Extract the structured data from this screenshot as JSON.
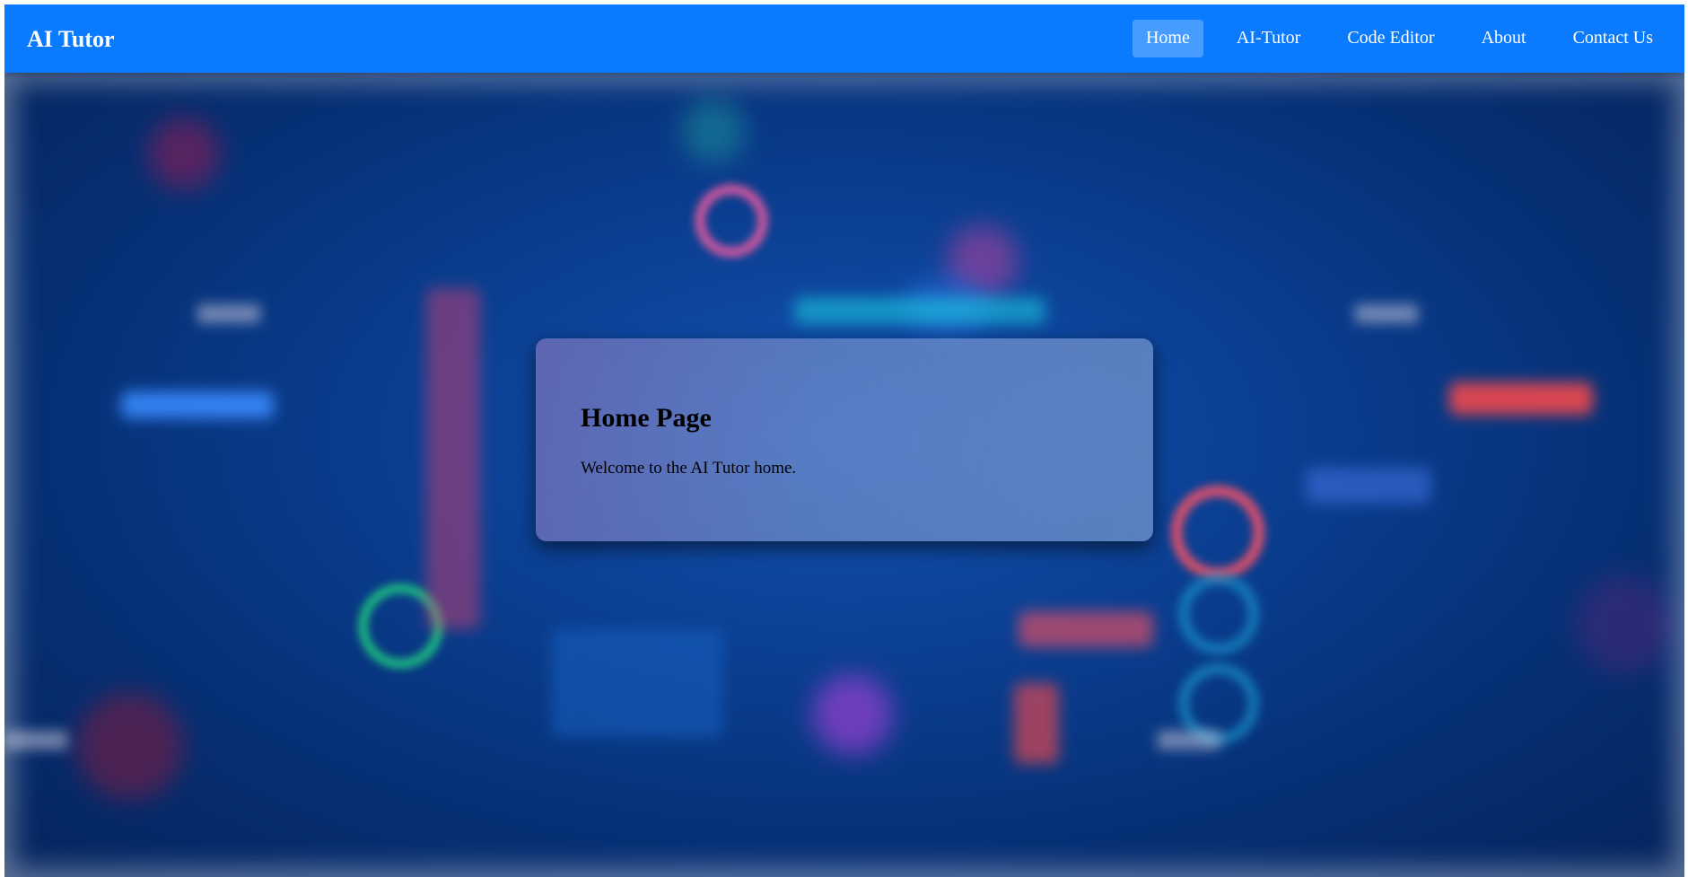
{
  "app": {
    "brand": "AI Tutor"
  },
  "nav": {
    "items": [
      {
        "label": "Home",
        "active": true
      },
      {
        "label": "AI-Tutor",
        "active": false
      },
      {
        "label": "Code Editor",
        "active": false
      },
      {
        "label": "About",
        "active": false
      },
      {
        "label": "Contact Us",
        "active": false
      }
    ]
  },
  "main": {
    "title": "Home Page",
    "text": "Welcome to the AI Tutor home."
  },
  "colors": {
    "navbar": "#0a7bff",
    "background": "#0b3f92",
    "text": "#000000"
  }
}
